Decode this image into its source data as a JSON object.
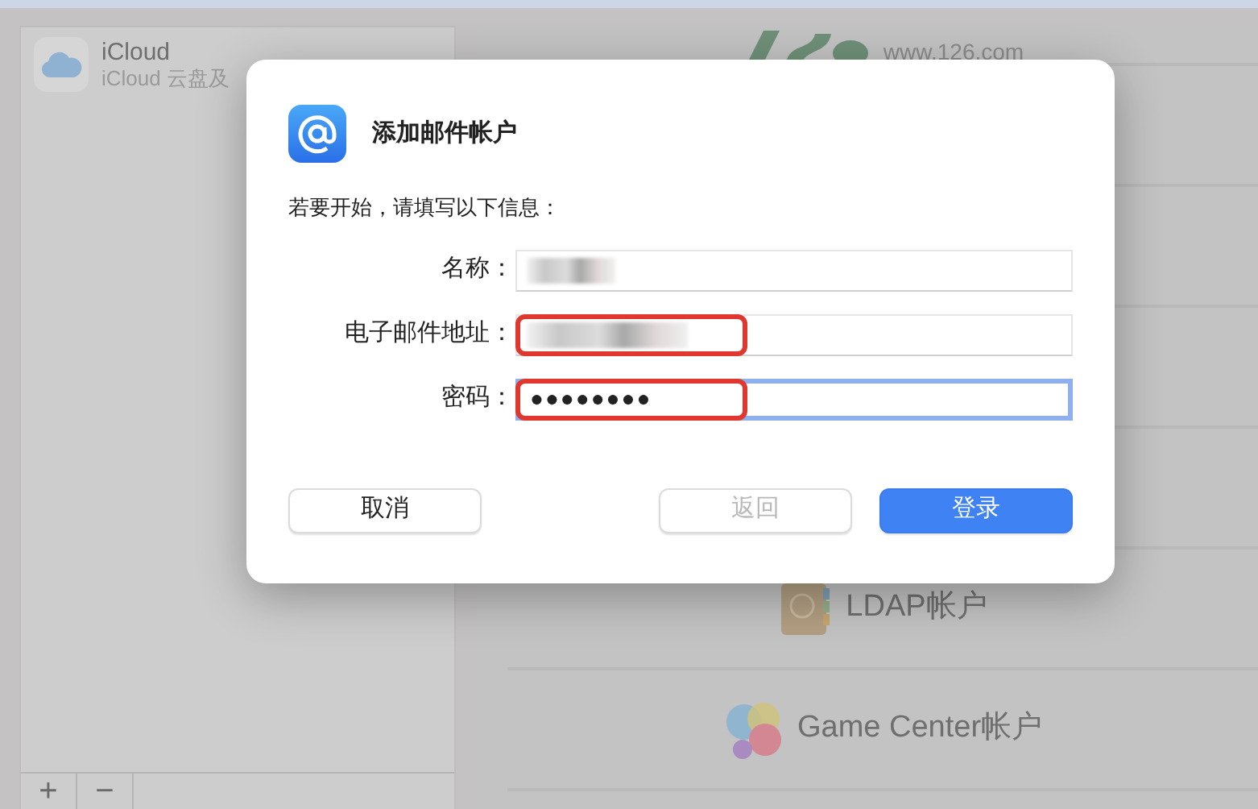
{
  "sidebar": {
    "items": [
      {
        "title": "iCloud",
        "subtitle": "iCloud 云盘及"
      }
    ],
    "toolbar": [
      "+",
      "−"
    ]
  },
  "providers": [
    {
      "kind": "logo126",
      "text": "www.126.com"
    },
    {
      "kind": "ldap",
      "label": "LDAP帐户"
    },
    {
      "kind": "gamecenter",
      "label": "Game Center帐户"
    }
  ],
  "dialog": {
    "title": "添加邮件帐户",
    "intro": "若要开始，请填写以下信息：",
    "fields": [
      {
        "label": "名称：",
        "kind": "redacted",
        "highlighted": false,
        "focused": false
      },
      {
        "label": "电子邮件地址：",
        "kind": "redacted",
        "highlighted": true,
        "focused": false
      },
      {
        "label": "密码：",
        "kind": "password",
        "value": "●●●●●●●●",
        "highlighted": true,
        "focused": true
      }
    ],
    "buttons": [
      {
        "label": "取消",
        "kind": "default",
        "disabled": false
      },
      {
        "label": "返回",
        "kind": "default",
        "disabled": true
      },
      {
        "label": "登录",
        "kind": "primary",
        "disabled": false
      }
    ]
  }
}
